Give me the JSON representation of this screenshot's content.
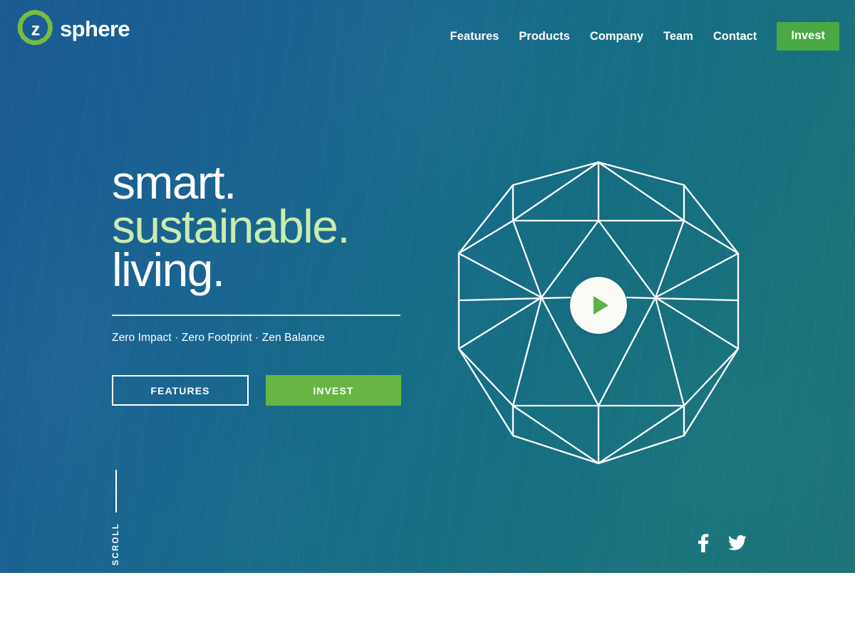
{
  "brand": {
    "mark_letter": "z",
    "word": "sphere",
    "mark_color": "#76bc43",
    "word_color": "#ffffff"
  },
  "header": {
    "nav": [
      {
        "label": "Features",
        "name": "nav-link-features"
      },
      {
        "label": "Products",
        "name": "nav-link-products"
      },
      {
        "label": "Company",
        "name": "nav-link-company"
      },
      {
        "label": "Team",
        "name": "nav-link-team"
      },
      {
        "label": "Contact",
        "name": "nav-link-contact"
      }
    ],
    "cta": {
      "label": "Invest",
      "color": "#4aa845"
    }
  },
  "hero": {
    "headline": {
      "line1": "smart.",
      "line2": "sustainable.",
      "line3": "living.",
      "line1_color": "#ffffff",
      "line2_color": "#c9edb0",
      "line3_color": "#ffffff"
    },
    "tagline": "Zero Impact · Zero Footprint · Zen Balance",
    "buttons": {
      "secondary": {
        "label": "FEATURES",
        "style": "outline"
      },
      "primary": {
        "label": "INVEST",
        "style": "solid",
        "color": "#67b545"
      }
    },
    "scroll_cue": {
      "label": "SCROLL"
    },
    "media": {
      "type": "geodesic-sphere-video",
      "play_icon": "play-icon",
      "play_triangle_color": "#5cb247",
      "wire_color": "#ffffff"
    },
    "background": {
      "gradient_from": "#1b5a93",
      "gradient_to": "#1d7279",
      "texture": "forest-photo-overlay"
    }
  },
  "social": [
    {
      "name": "facebook-icon",
      "label": "Facebook"
    },
    {
      "name": "twitter-icon",
      "label": "Twitter"
    }
  ]
}
